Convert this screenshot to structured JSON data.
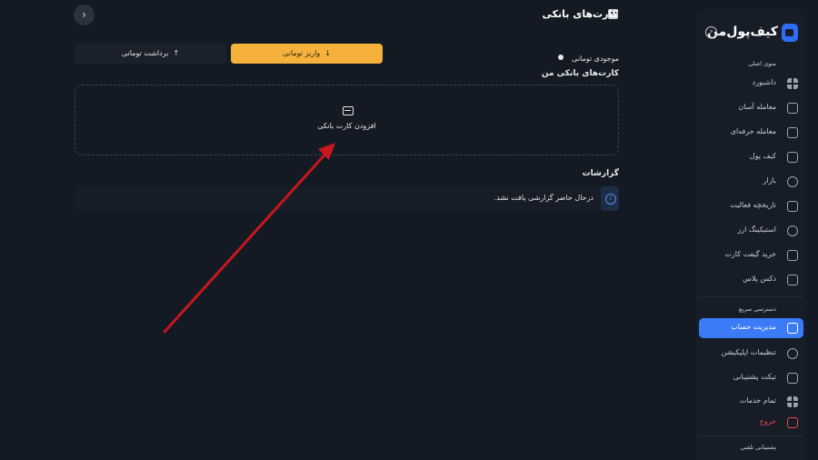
{
  "sidebar": {
    "brand": "کیف‌پول‌من",
    "collapse_glyph": "‹",
    "main_menu_title": "منوی اصلی",
    "main_items": [
      {
        "label": "داشبورد",
        "icon": "grid-icon"
      },
      {
        "label": "معامله آسان",
        "icon": "easy-trade-icon"
      },
      {
        "label": "معامله حرفه‌ای",
        "icon": "pro-trade-icon"
      },
      {
        "label": "کیف پول",
        "icon": "wallet-icon"
      },
      {
        "label": "بازار",
        "icon": "market-icon"
      },
      {
        "label": "تاریخچه فعالیت",
        "icon": "history-icon"
      },
      {
        "label": "استیکینگ ارز",
        "icon": "staking-icon"
      },
      {
        "label": "خرید گیفت کارت",
        "icon": "gift-card-icon"
      },
      {
        "label": "دکس پلاس",
        "icon": "dex-plus-icon"
      }
    ],
    "quick_access_title": "دسترسی سریع",
    "quick_items": [
      {
        "label": "مدیریت حساب",
        "icon": "account-icon",
        "active": true
      },
      {
        "label": "تنظیمات اپلیکیشن",
        "icon": "settings-icon",
        "active": false
      },
      {
        "label": "تیکت پشتیبانی",
        "icon": "ticket-icon",
        "active": false
      },
      {
        "label": "تمام خدمات",
        "icon": "services-grid-icon",
        "active": false
      }
    ],
    "logout_label": "خروج",
    "support_title": "پشتیبانی تلفنی"
  },
  "main": {
    "page_title": "کارت‌های بانکی",
    "back_glyph": "‹",
    "balance_label": "موجودی تومانی",
    "deposit_label": "واریز تومانی",
    "deposit_glyph": "↓",
    "withdraw_label": "برداشت تومانی",
    "withdraw_glyph": "↑",
    "cards_heading": "کارت‌های بانکی من",
    "add_card_label": "افزودن کارت بانکی",
    "reports_heading": "گزارشات",
    "reports_empty": "درحال حاضر گزارشی یافت نشد."
  },
  "colors": {
    "background": "#141a23",
    "sidebar": "#161d27",
    "accent_blue": "#3b7cf6",
    "deposit_yellow": "#f6b13c",
    "logout_red": "#e5484d",
    "annotation_arrow": "#c8161e"
  }
}
